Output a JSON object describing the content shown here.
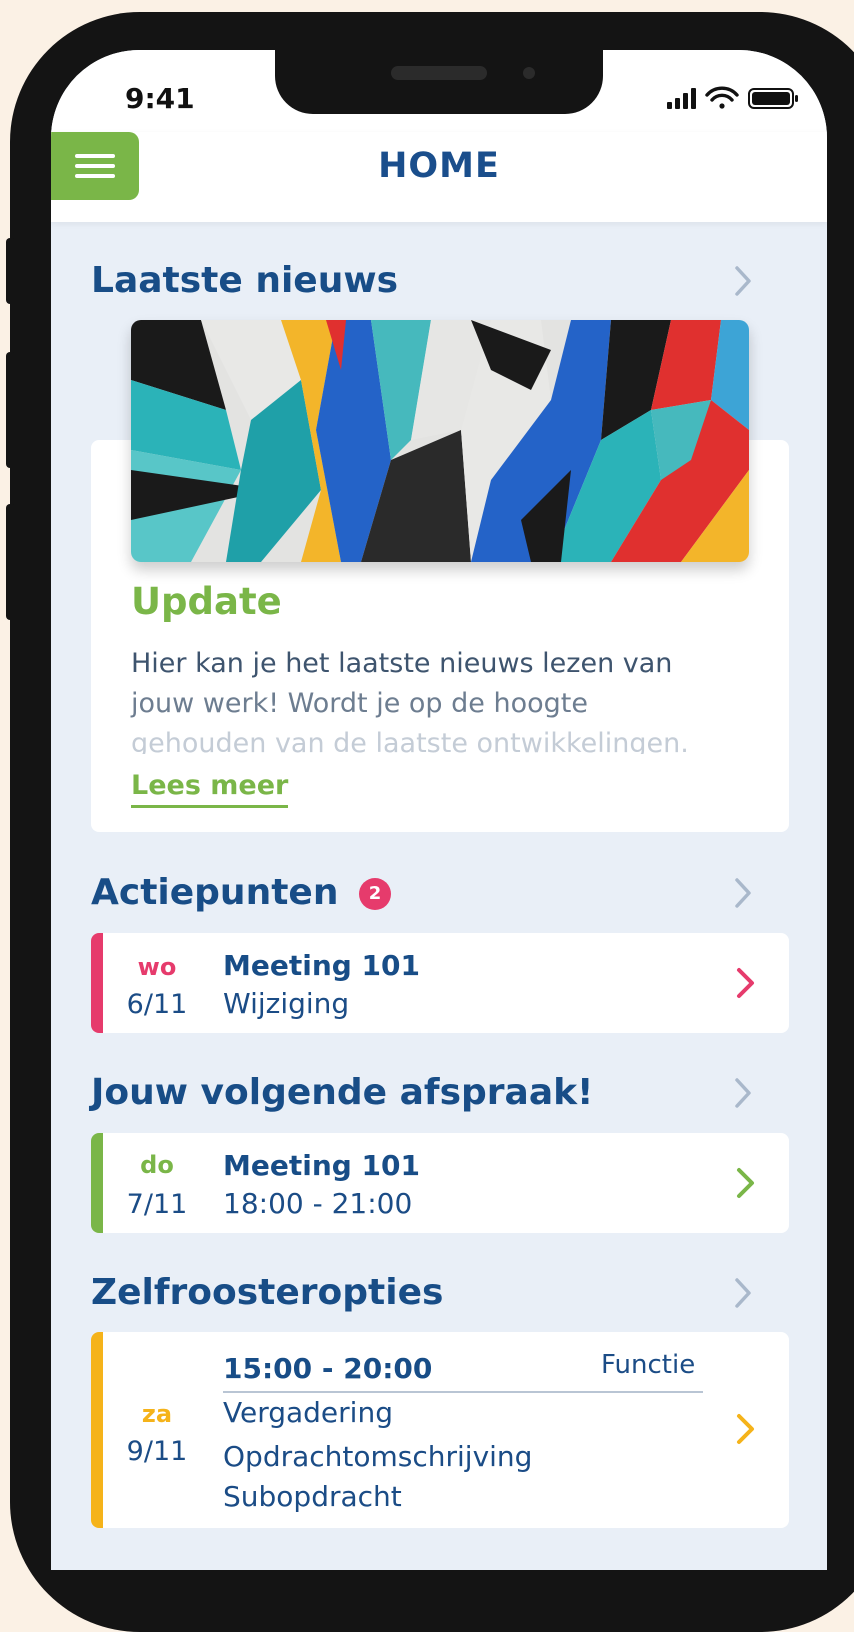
{
  "status": {
    "time": "9:41"
  },
  "header": {
    "title": "HOME"
  },
  "news": {
    "title": "Laatste nieuws",
    "card_title": "Update",
    "text_line1": "Hier kan je het laatste nieuws lezen van",
    "text_line2": "jouw werk! Wordt je op de hoogte",
    "text_line3": "gehouden van de laatste ontwikkelingen.",
    "read_more": "Lees meer"
  },
  "actions": {
    "title": "Actiepunten",
    "badge": "2",
    "item": {
      "day": "wo",
      "date": "6/11",
      "title": "Meeting 101",
      "subtitle": "Wijziging"
    }
  },
  "next_appointment": {
    "title": "Jouw volgende afspraak!",
    "item": {
      "day": "do",
      "date": "7/11",
      "title": "Meeting 101",
      "subtitle": "18:00 - 21:00"
    }
  },
  "self_schedule": {
    "title": "Zelfroosteropties",
    "item": {
      "day": "za",
      "date": "9/11",
      "time": "15:00 - 20:00",
      "function_label": "Functie",
      "line1": "Vergadering",
      "line2": "Opdrachtomschrijving",
      "line3": "Subopdracht"
    }
  },
  "colors": {
    "brand_blue": "#184d87",
    "green": "#7ab648",
    "pink": "#e63b6c",
    "yellow": "#f5b31a",
    "background": "#e9eff7"
  }
}
